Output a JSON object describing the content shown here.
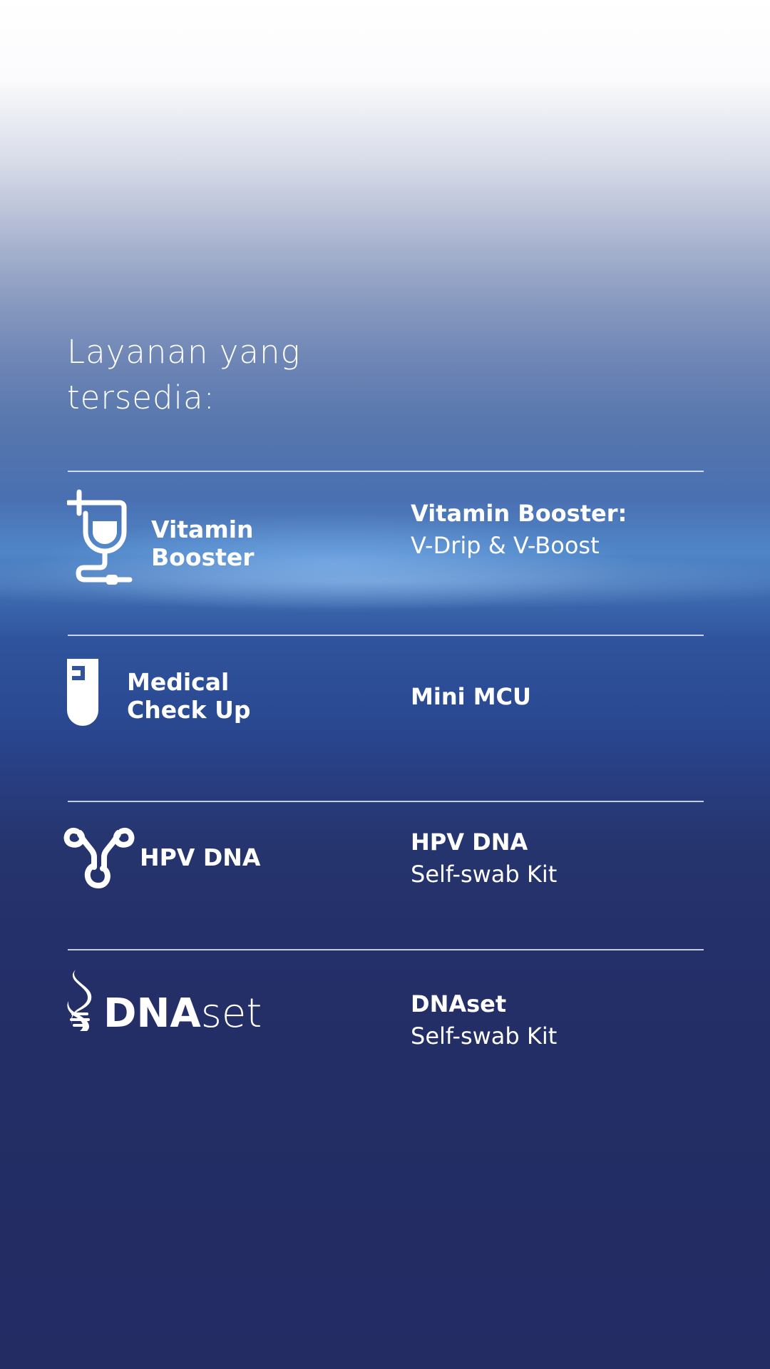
{
  "heading": {
    "line1": "Layanan yang",
    "line2": "tersedia:"
  },
  "services": [
    {
      "icon": "iv-drip-icon",
      "label_line1": "Vitamin",
      "label_line2": "Booster",
      "title": "Vitamin Booster:",
      "subtitle": "V-Drip & V-Boost"
    },
    {
      "icon": "test-tube-icon",
      "label_line1": "Medical",
      "label_line2": "Check Up",
      "title": "Mini MCU",
      "subtitle": ""
    },
    {
      "icon": "uterus-icon",
      "label_line1": "HPV DNA",
      "label_line2": "",
      "title": "HPV DNA",
      "subtitle": "Self-swab Kit"
    },
    {
      "icon": "dna-helix-icon",
      "logo_bold": "DNA",
      "logo_light": "set",
      "title": "DNAset",
      "subtitle": "Self-swab Kit"
    }
  ],
  "colors": {
    "text": "#ffffff",
    "background_top": "#ffffff",
    "background_bottom": "#232c63",
    "accent_highlight": "#4f86c8"
  }
}
